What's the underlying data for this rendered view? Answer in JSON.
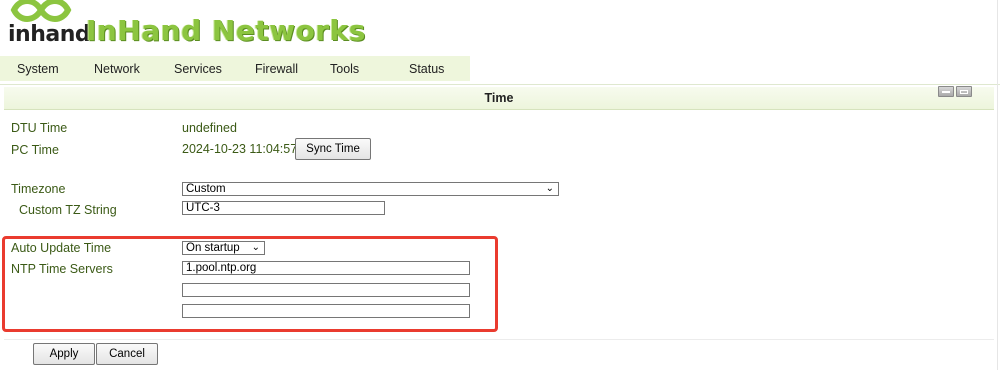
{
  "brand": {
    "logo_text": "inhand",
    "name": "InHand Networks"
  },
  "nav": {
    "items": [
      "System",
      "Network",
      "Services",
      "Firewall",
      "Tools",
      "Status"
    ]
  },
  "page": {
    "title": "Time"
  },
  "time": {
    "dtu_label": "DTU Time",
    "dtu_value": "undefined",
    "pc_label": "PC Time",
    "pc_value": "2024-10-23 11:04:57",
    "sync_button": "Sync Time"
  },
  "timezone": {
    "label": "Timezone",
    "value": "Custom",
    "custom_label": "Custom TZ String",
    "custom_value": "UTC-3"
  },
  "ntp": {
    "auto_label": "Auto Update Time",
    "auto_value": "On startup",
    "servers_label": "NTP Time Servers",
    "servers": [
      "1.pool.ntp.org",
      "",
      ""
    ]
  },
  "actions": {
    "apply": "Apply",
    "cancel": "Cancel"
  },
  "colors": {
    "accent": "#8cc540",
    "label": "#3b5a16",
    "highlight": "#ea3b2f",
    "nav_bg": "#eef6dc"
  }
}
